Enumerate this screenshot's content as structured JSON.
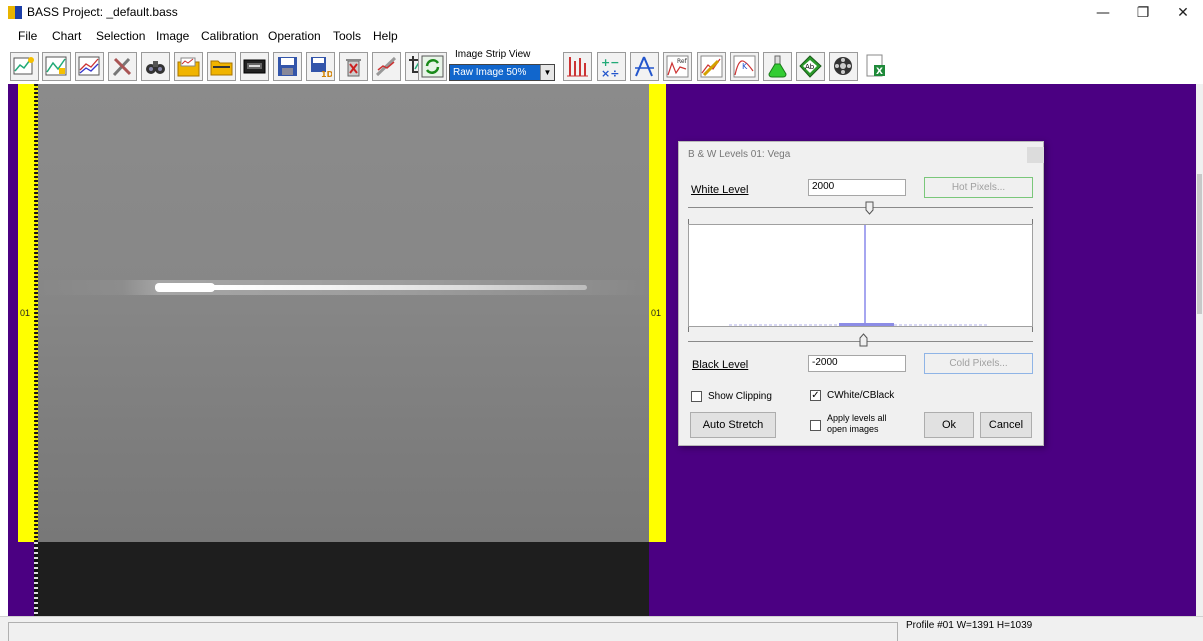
{
  "window": {
    "title": "BASS Project: _default.bass",
    "minimize_glyph": "—",
    "maximize_glyph": "❐",
    "close_glyph": "✕"
  },
  "menu": [
    "File",
    "Chart",
    "Selection",
    "Image",
    "Calibration",
    "Operation",
    "Tools",
    "Help"
  ],
  "toolbar": {
    "left_icons": [
      "new-chart-icon",
      "chart-icon",
      "compare-chart-icon",
      "tools-icon",
      "binoculars-icon",
      "open-spectrum-icon",
      "open-folder-icon",
      "camera-icon",
      "save-icon",
      "save-1d-icon",
      "delete-icon",
      "tweak-icon",
      "crop-icon",
      "refresh-icon"
    ],
    "strip_label": "Image Strip View",
    "strip_value": "Raw Image 50%",
    "right_icons": [
      "bars-icon",
      "math-ops-icon",
      "compass-icon",
      "reference-icon",
      "calibrate-icon",
      "k-curve-icon",
      "flask-icon",
      "abs-icon",
      "film-icon",
      "excel-icon"
    ]
  },
  "image_view": {
    "left_label": "01",
    "right_label": "01"
  },
  "levels_dialog": {
    "title": "B & W Levels 01: Vega",
    "white_label": "White Level",
    "white_value": "2000",
    "hot_pixels": "Hot Pixels...",
    "black_label": "Black Level",
    "black_value": "-2000",
    "cold_pixels": "Cold Pixels...",
    "show_clipping": {
      "label": "Show Clipping",
      "checked": false
    },
    "cwhite_cblack": {
      "label": "CWhite/CBlack",
      "checked": true,
      "mark": "✓"
    },
    "apply_all": {
      "label_line1": "Apply levels all",
      "label_line2": "open images",
      "checked": false
    },
    "auto_stretch": "Auto Stretch",
    "ok": "Ok",
    "cancel": "Cancel"
  },
  "status": {
    "profile": "Profile #01 W=1391 H=1039"
  },
  "colors": {
    "workspace_bg": "#4b0082",
    "frame_yellow": "#ffff00",
    "select_blue": "#1166cc",
    "histogram_blue": "#6a6ae6"
  }
}
